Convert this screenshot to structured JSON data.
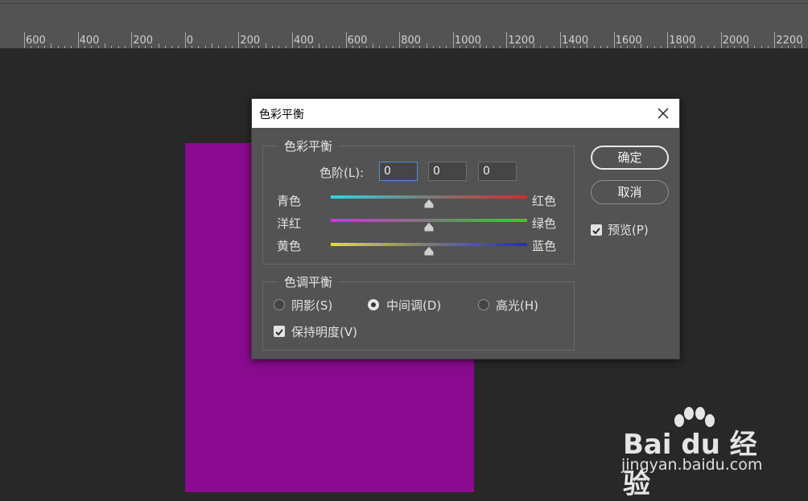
{
  "ruler": {
    "labels": [
      "600",
      "400",
      "200",
      "0",
      "200",
      "400",
      "600",
      "800",
      "1000",
      "1200",
      "1400",
      "1600",
      "1800",
      "2000",
      "2200"
    ]
  },
  "dialog": {
    "title": "色彩平衡",
    "color_balance": {
      "legend": "色彩平衡",
      "levels_label": "色阶(L):",
      "levels": [
        "0",
        "0",
        "0"
      ],
      "sliders": [
        {
          "left": "青色",
          "right": "红色",
          "value": 0,
          "colors": [
            "#2fd6df",
            "#d62b2b"
          ]
        },
        {
          "left": "洋红",
          "right": "绿色",
          "value": 0,
          "colors": [
            "#d42fd9",
            "#2ed12e"
          ]
        },
        {
          "left": "黄色",
          "right": "蓝色",
          "value": 0,
          "colors": [
            "#e2e02a",
            "#2626d8"
          ]
        }
      ]
    },
    "tone_balance": {
      "legend": "色调平衡",
      "options": [
        {
          "label": "阴影(S)",
          "selected": false
        },
        {
          "label": "中间调(D)",
          "selected": true
        },
        {
          "label": "高光(H)",
          "selected": false
        }
      ],
      "preserve_luminosity": {
        "label": "保持明度(V)",
        "checked": true
      }
    },
    "ok_label": "确定",
    "cancel_label": "取消",
    "preview": {
      "label": "预览(P)",
      "checked": true
    }
  },
  "watermark": {
    "brand": "Bai du 经验",
    "url": "jingyan.baidu.com"
  },
  "colors": {
    "document": "#8a0b8f",
    "background": "#282828",
    "dialog": "#535353"
  }
}
